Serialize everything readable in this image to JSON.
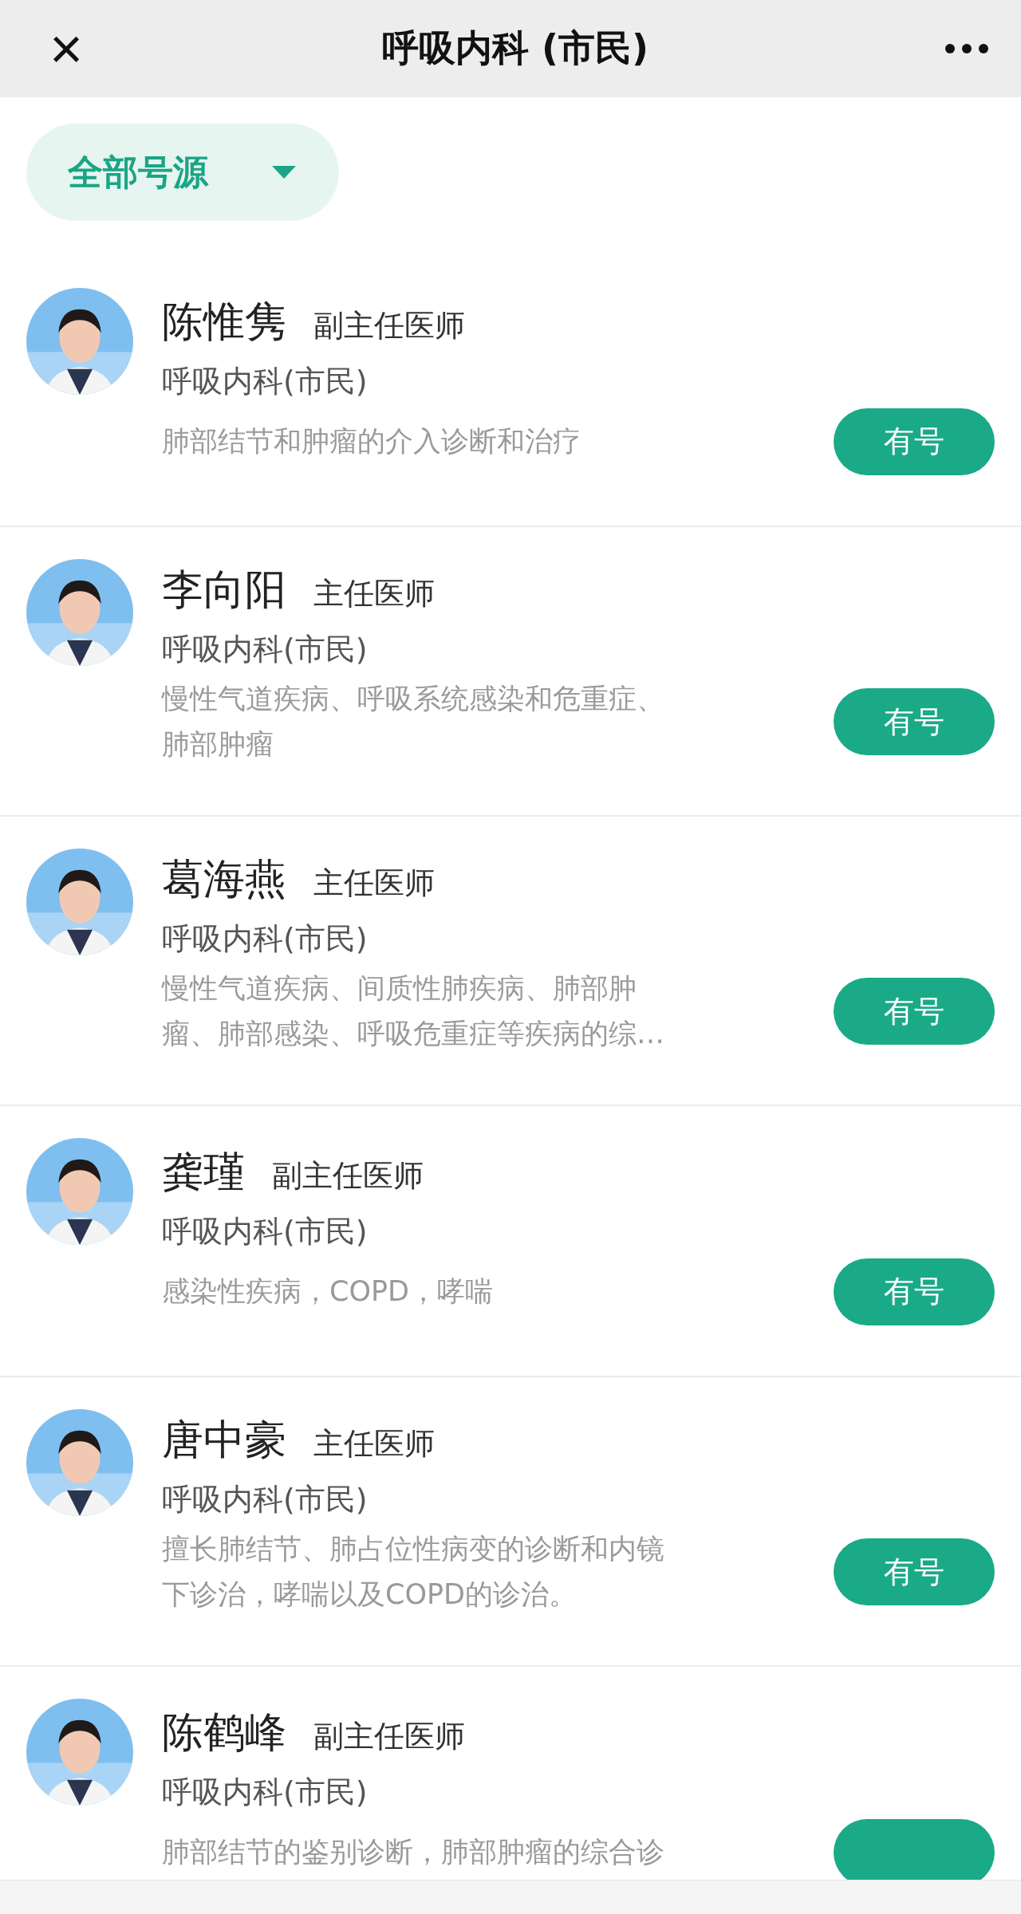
{
  "header": {
    "close_icon": "×",
    "title": "呼吸内科 (市民)"
  },
  "filter": {
    "label": "全部号源"
  },
  "doctors": [
    {
      "name": "陈惟隽",
      "title": "副主任医师",
      "department": "呼吸内科(市民)",
      "specialty": "肺部结节和肿瘤的介入诊断和治疗",
      "button": "有号"
    },
    {
      "name": "李向阳",
      "title": "主任医师",
      "department": "呼吸内科(市民)",
      "specialty": "慢性气道疾病、呼吸系统感染和危重症、肺部肿瘤",
      "button": "有号"
    },
    {
      "name": "葛海燕",
      "title": "主任医师",
      "department": "呼吸内科(市民)",
      "specialty": "慢性气道疾病、间质性肺疾病、肺部肿瘤、肺部感染、呼吸危重症等疾病的综…",
      "button": "有号"
    },
    {
      "name": "龚瑾",
      "title": "副主任医师",
      "department": "呼吸内科(市民)",
      "specialty": "感染性疾病，COPD，哮喘",
      "button": "有号"
    },
    {
      "name": "唐中豪",
      "title": "主任医师",
      "department": "呼吸内科(市民)",
      "specialty": "擅长肺结节、肺占位性病变的诊断和内镜下诊治，哮喘以及COPD的诊治。",
      "button": "有号"
    },
    {
      "name": "陈鹤峰",
      "title": "副主任医师",
      "department": "呼吸内科(市民)",
      "specialty": "肺部结节的鉴别诊断，肺部肿瘤的综合诊"
    }
  ]
}
